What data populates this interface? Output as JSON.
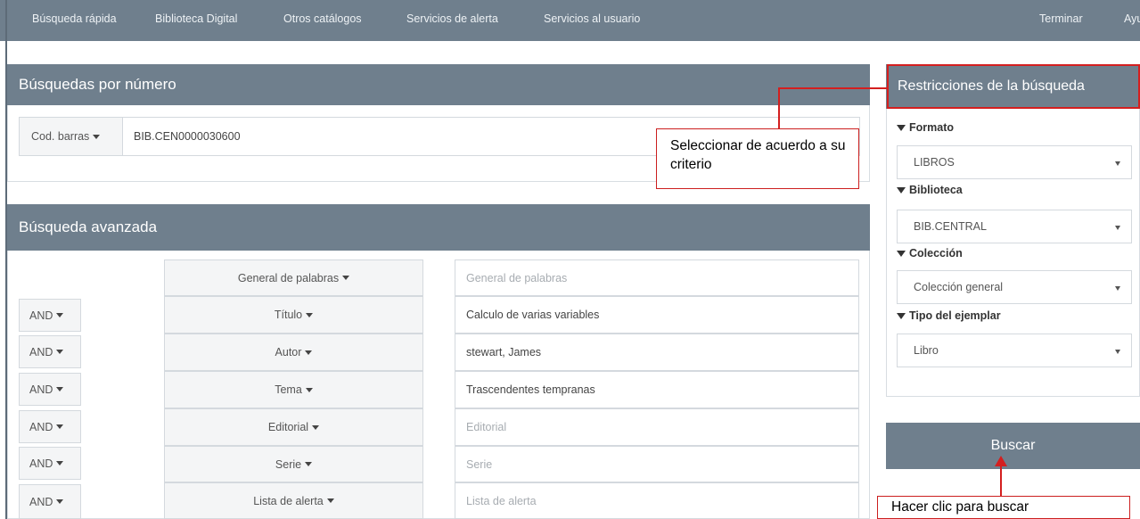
{
  "topnav": {
    "items": [
      "Búsqueda rápida",
      "Biblioteca Digital",
      "Otros catálogos",
      "Servicios de alerta",
      "Servicios al usuario"
    ],
    "right_items": [
      "Terminar",
      "Ayuda"
    ]
  },
  "number_search": {
    "title": "Búsquedas por número",
    "type_label": "Cod. barras",
    "value": "BIB.CEN0000030600"
  },
  "advanced_search": {
    "title": "Búsqueda avanzada",
    "rows": [
      {
        "operator": "",
        "field": "General de palabras",
        "value": "",
        "placeholder": "General de palabras"
      },
      {
        "operator": "AND",
        "field": "Título",
        "value": "Calculo de varias variables",
        "placeholder": ""
      },
      {
        "operator": "AND",
        "field": "Autor",
        "value": "stewart, James",
        "placeholder": ""
      },
      {
        "operator": "AND",
        "field": "Tema",
        "value": "Trascendentes tempranas",
        "placeholder": ""
      },
      {
        "operator": "AND",
        "field": "Editorial",
        "value": "",
        "placeholder": "Editorial"
      },
      {
        "operator": "AND",
        "field": "Serie",
        "value": "",
        "placeholder": "Serie"
      },
      {
        "operator": "AND",
        "field": "Lista de alerta",
        "value": "",
        "placeholder": "Lista de alerta"
      }
    ]
  },
  "restrictions": {
    "title": "Restricciones de la búsqueda",
    "filters": [
      {
        "label": "Formato",
        "value": "LIBROS"
      },
      {
        "label": "Biblioteca",
        "value": "BIB.CENTRAL"
      },
      {
        "label": "Colección",
        "value": "Colección general"
      },
      {
        "label": "Tipo del ejemplar",
        "value": "Libro"
      }
    ]
  },
  "search_button": {
    "label": "Buscar"
  },
  "annotations": {
    "criteria_note": "Seleccionar de acuerdo a su criterio",
    "click_note": "Hacer clic para buscar"
  },
  "colors": {
    "header": "#6f7f8d",
    "annotation": "#d41f1f"
  }
}
